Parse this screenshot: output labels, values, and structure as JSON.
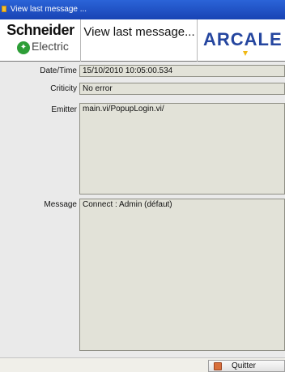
{
  "window": {
    "title": "View last message ..."
  },
  "header": {
    "logo": {
      "line1": "Schneider",
      "line2": "Electric"
    },
    "title": "View last message...",
    "brand": "ARCALE"
  },
  "fields": {
    "datetime": {
      "label": "Date/Time",
      "value": "15/10/2010 10:05:00.534"
    },
    "criticity": {
      "label": "Criticity",
      "value": "No error"
    },
    "emitter": {
      "label": "Emitter",
      "value": "main.vi/PopupLogin.vi/"
    },
    "message": {
      "label": "Message",
      "value": "Connect :  Admin (défaut)"
    }
  },
  "actions": {
    "quit": "Quitter"
  },
  "colors": {
    "title_bar": "#1d4fc5",
    "background": "#eaeaea",
    "field": "#e2e2d8",
    "brand": "#25469f"
  }
}
